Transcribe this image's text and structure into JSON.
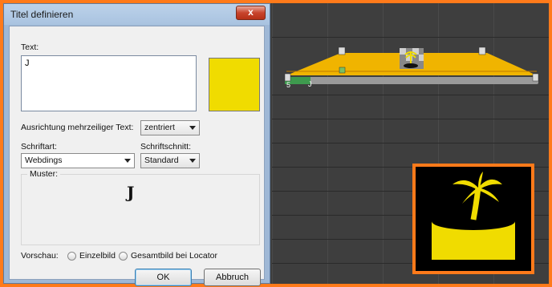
{
  "dialog": {
    "title": "Titel definieren",
    "close_glyph": "x",
    "text_label": "Text:",
    "text_value": "J",
    "color": "#f0dc00",
    "alignment_label": "Ausrichtung mehrzeiliger Text:",
    "alignment_value": "zentriert",
    "font_label": "Schriftart:",
    "font_value": "Webdings",
    "style_label": "Schriftschnitt:",
    "style_value": "Standard",
    "sample_label": "Muster:",
    "sample_text": "J",
    "preview_label": "Vorschau:",
    "preview_options": [
      "Einzelbild",
      "Gesamtbild bei Locator"
    ],
    "ok_label": "OK",
    "cancel_label": "Abbruch"
  },
  "timeline": {
    "clip_color": "#f0b400",
    "marker_glyph": "J",
    "start_digit": "5"
  },
  "colors": {
    "accent": "#ff7a1a",
    "title_yellow": "#f0dc00"
  }
}
